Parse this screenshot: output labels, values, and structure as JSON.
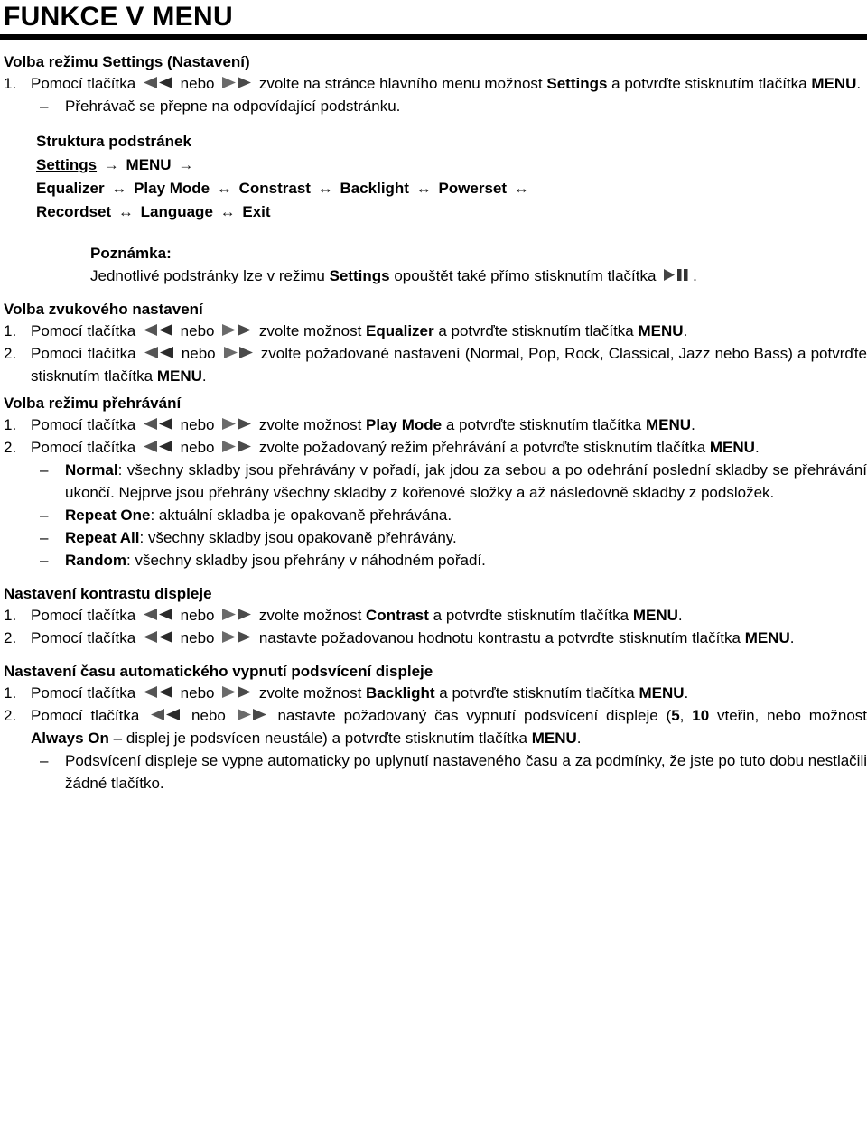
{
  "document": {
    "title": "FUNKCE V MENU"
  },
  "icons": {
    "prev": "rewind-icon",
    "next": "fast-forward-icon",
    "playpause": "play-pause-icon"
  },
  "sections": [
    {
      "id": "settings-mode",
      "heading": "Volba režimu Settings (Nastavení)",
      "steps": [
        {
          "num": "1.",
          "parts": [
            {
              "t": "text",
              "v": "Pomocí tlačítka "
            },
            {
              "t": "icon",
              "v": "prev"
            },
            {
              "t": "text",
              "v": " nebo "
            },
            {
              "t": "icon",
              "v": "next"
            },
            {
              "t": "text",
              "v": " zvolte na stránce hlavního menu možnost "
            },
            {
              "t": "bold",
              "v": "Settings"
            },
            {
              "t": "text",
              "v": " a potvrďte stisknutím tlačítka "
            },
            {
              "t": "bold",
              "v": "MENU"
            },
            {
              "t": "text",
              "v": "."
            }
          ]
        }
      ],
      "dashes": [
        {
          "parts": [
            {
              "t": "text",
              "v": "Přehrávač se přepne na odpovídající podstránku."
            }
          ]
        }
      ]
    },
    {
      "id": "structure",
      "heading": "Struktura podstránek",
      "structure_lines": [
        [
          {
            "t": "underline",
            "v": "Settings"
          },
          {
            "t": "arrow",
            "v": "→"
          },
          {
            "t": "bold",
            "v": "MENU"
          },
          {
            "t": "arrow",
            "v": "→"
          }
        ],
        [
          {
            "t": "bold",
            "v": "Equalizer"
          },
          {
            "t": "arrow",
            "v": "↔"
          },
          {
            "t": "bold",
            "v": "Play Mode"
          },
          {
            "t": "arrow",
            "v": "↔"
          },
          {
            "t": "bold",
            "v": "Constrast"
          },
          {
            "t": "arrow",
            "v": "↔"
          },
          {
            "t": "bold",
            "v": "Backlight"
          },
          {
            "t": "arrow",
            "v": "↔"
          },
          {
            "t": "bold",
            "v": "Powerset"
          },
          {
            "t": "arrow",
            "v": "↔"
          }
        ],
        [
          {
            "t": "bold",
            "v": "Recordset"
          },
          {
            "t": "arrow",
            "v": "↔"
          },
          {
            "t": "bold",
            "v": "Language"
          },
          {
            "t": "arrow",
            "v": "↔"
          },
          {
            "t": "bold",
            "v": "Exit"
          }
        ]
      ]
    },
    {
      "id": "note",
      "note_title": "Poznámka:",
      "note_parts": [
        {
          "t": "text",
          "v": "Jednotlivé podstránky lze v režimu "
        },
        {
          "t": "bold",
          "v": "Settings"
        },
        {
          "t": "text",
          "v": " opouštět také přímo stisknutím tlačítka "
        },
        {
          "t": "icon",
          "v": "playpause"
        },
        {
          "t": "text",
          "v": "."
        }
      ]
    },
    {
      "id": "equalizer",
      "heading": "Volba zvukového nastavení",
      "steps": [
        {
          "num": "1.",
          "parts": [
            {
              "t": "text",
              "v": "Pomocí tlačítka "
            },
            {
              "t": "icon",
              "v": "prev"
            },
            {
              "t": "text",
              "v": " nebo "
            },
            {
              "t": "icon",
              "v": "next"
            },
            {
              "t": "text",
              "v": " zvolte možnost "
            },
            {
              "t": "bold",
              "v": "Equalizer"
            },
            {
              "t": "text",
              "v": " a potvrďte stisknutím tlačítka "
            },
            {
              "t": "bold",
              "v": "MENU"
            },
            {
              "t": "text",
              "v": "."
            }
          ]
        },
        {
          "num": "2.",
          "parts": [
            {
              "t": "text",
              "v": "Pomocí tlačítka "
            },
            {
              "t": "icon",
              "v": "prev"
            },
            {
              "t": "text",
              "v": " nebo "
            },
            {
              "t": "icon",
              "v": "next"
            },
            {
              "t": "text",
              "v": " zvolte požadované nastavení (Normal, Pop, Rock, Classical, Jazz nebo Bass) a potvrďte stisknutím tlačítka "
            },
            {
              "t": "bold",
              "v": "MENU"
            },
            {
              "t": "text",
              "v": "."
            }
          ]
        }
      ]
    },
    {
      "id": "play-mode",
      "heading": "Volba režimu přehrávání",
      "steps": [
        {
          "num": "1.",
          "parts": [
            {
              "t": "text",
              "v": "Pomocí tlačítka "
            },
            {
              "t": "icon",
              "v": "prev"
            },
            {
              "t": "text",
              "v": " nebo "
            },
            {
              "t": "icon",
              "v": "next"
            },
            {
              "t": "text",
              "v": " zvolte možnost "
            },
            {
              "t": "bold",
              "v": "Play Mode"
            },
            {
              "t": "text",
              "v": " a potvrďte stisknutím tlačítka "
            },
            {
              "t": "bold",
              "v": "MENU"
            },
            {
              "t": "text",
              "v": "."
            }
          ]
        },
        {
          "num": "2.",
          "parts": [
            {
              "t": "text",
              "v": "Pomocí tlačítka "
            },
            {
              "t": "icon",
              "v": "prev"
            },
            {
              "t": "text",
              "v": " nebo "
            },
            {
              "t": "icon",
              "v": "next"
            },
            {
              "t": "text",
              "v": " zvolte požadovaný režim přehrávání a potvrďte stisknutím tlačítka "
            },
            {
              "t": "bold",
              "v": "MENU"
            },
            {
              "t": "text",
              "v": "."
            }
          ]
        }
      ],
      "dashes": [
        {
          "parts": [
            {
              "t": "bold",
              "v": "Normal"
            },
            {
              "t": "text",
              "v": ": všechny skladby jsou přehrávány v pořadí, jak jdou za sebou a po odehrání poslední skladby se přehrávání ukončí. Nejprve jsou přehrány všechny skladby z kořenové složky a až následovně skladby z podsložek."
            }
          ]
        },
        {
          "parts": [
            {
              "t": "bold",
              "v": "Repeat One"
            },
            {
              "t": "text",
              "v": ": aktuální skladba je opakovaně přehrávána."
            }
          ]
        },
        {
          "parts": [
            {
              "t": "bold",
              "v": "Repeat All"
            },
            {
              "t": "text",
              "v": ": všechny skladby jsou opakovaně přehrávány."
            }
          ]
        },
        {
          "parts": [
            {
              "t": "bold",
              "v": "Random"
            },
            {
              "t": "text",
              "v": ": všechny skladby jsou přehrány v náhodném pořadí."
            }
          ]
        }
      ]
    },
    {
      "id": "contrast",
      "heading": "Nastavení kontrastu displeje",
      "steps": [
        {
          "num": "1.",
          "parts": [
            {
              "t": "text",
              "v": "Pomocí tlačítka "
            },
            {
              "t": "icon",
              "v": "prev"
            },
            {
              "t": "text",
              "v": " nebo "
            },
            {
              "t": "icon",
              "v": "next"
            },
            {
              "t": "text",
              "v": " zvolte možnost "
            },
            {
              "t": "bold",
              "v": "Contrast"
            },
            {
              "t": "text",
              "v": " a potvrďte stisknutím tlačítka "
            },
            {
              "t": "bold",
              "v": "MENU"
            },
            {
              "t": "text",
              "v": "."
            }
          ]
        },
        {
          "num": "2.",
          "parts": [
            {
              "t": "text",
              "v": "Pomocí tlačítka "
            },
            {
              "t": "icon",
              "v": "prev"
            },
            {
              "t": "text",
              "v": " nebo "
            },
            {
              "t": "icon",
              "v": "next"
            },
            {
              "t": "text",
              "v": " nastavte požadovanou hodnotu kontrastu a potvrďte stisknutím tlačítka "
            },
            {
              "t": "bold",
              "v": "MENU"
            },
            {
              "t": "text",
              "v": "."
            }
          ]
        }
      ]
    },
    {
      "id": "backlight",
      "heading": "Nastavení času automatického vypnutí podsvícení displeje",
      "steps": [
        {
          "num": "1.",
          "parts": [
            {
              "t": "text",
              "v": "Pomocí tlačítka "
            },
            {
              "t": "icon",
              "v": "prev"
            },
            {
              "t": "text",
              "v": " nebo "
            },
            {
              "t": "icon",
              "v": "next"
            },
            {
              "t": "text",
              "v": " zvolte možnost "
            },
            {
              "t": "bold",
              "v": "Backlight"
            },
            {
              "t": "text",
              "v": " a potvrďte stisknutím tlačítka "
            },
            {
              "t": "bold",
              "v": "MENU"
            },
            {
              "t": "text",
              "v": "."
            }
          ]
        },
        {
          "num": "2.",
          "parts": [
            {
              "t": "text",
              "v": "Pomocí tlačítka "
            },
            {
              "t": "icon",
              "v": "prev"
            },
            {
              "t": "text",
              "v": " nebo "
            },
            {
              "t": "icon",
              "v": "next"
            },
            {
              "t": "text",
              "v": " nastavte požadovaný čas vypnutí podsvícení displeje ("
            },
            {
              "t": "bold",
              "v": "5"
            },
            {
              "t": "text",
              "v": ", "
            },
            {
              "t": "bold",
              "v": "10"
            },
            {
              "t": "text",
              "v": " vteřin, nebo možnost "
            },
            {
              "t": "bold",
              "v": "Always On"
            },
            {
              "t": "text",
              "v": " – displej je podsvícen neustále) a potvrďte stisknutím tlačítka "
            },
            {
              "t": "bold",
              "v": "MENU"
            },
            {
              "t": "text",
              "v": "."
            }
          ]
        }
      ],
      "dashes": [
        {
          "parts": [
            {
              "t": "text",
              "v": "Podsvícení displeje se vypne automaticky po uplynutí nastaveného času a za podmínky, že jste po tuto dobu nestlačili žádné tlačítko."
            }
          ]
        }
      ]
    }
  ]
}
